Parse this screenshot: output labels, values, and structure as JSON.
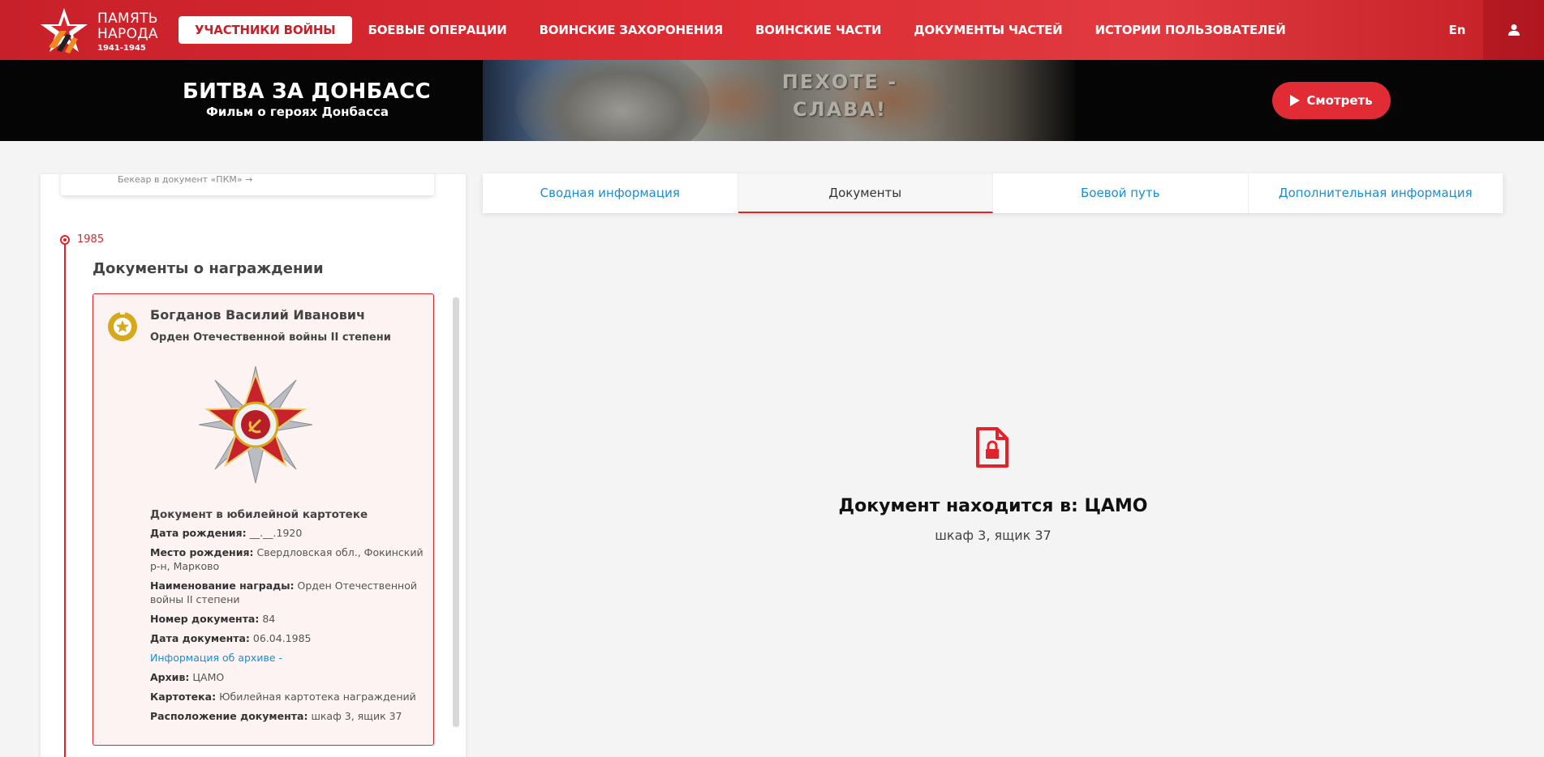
{
  "header": {
    "logo": {
      "line1": "ПАМЯТЬ",
      "line2": "НАРОДА",
      "years": "1941-1945"
    },
    "nav": [
      {
        "label": "УЧАСТНИКИ ВОЙНЫ",
        "active": true
      },
      {
        "label": "БОЕВЫЕ ОПЕРАЦИИ",
        "active": false
      },
      {
        "label": "ВОИНСКИЕ ЗАХОРОНЕНИЯ",
        "active": false
      },
      {
        "label": "ВОИНСКИЕ ЧАСТИ",
        "active": false
      },
      {
        "label": "ДОКУМЕНТЫ ЧАСТЕЙ",
        "active": false
      },
      {
        "label": "ИСТОРИИ ПОЛЬЗОВАТЕЛЕЙ",
        "active": false
      }
    ],
    "lang": "En",
    "user_icon": "user-icon"
  },
  "banner": {
    "title": "БИТВА ЗА ДОНБАСС",
    "subtitle": "Фильм о героях Донбасса",
    "inscription_line1": "ПЕХОТЕ -",
    "inscription_line2": "СЛАВА!",
    "watch_label": "Смотреть"
  },
  "sidebar": {
    "prev_card_text": "Бекеар в документ «ПКМ» →",
    "year": "1985",
    "section_title": "Документы о награждении",
    "award": {
      "name": "Богданов Василий Иванович",
      "title": "Орден Отечественной войны II степени",
      "doc_heading": "Документ в юбилейной картотеке",
      "fields": [
        {
          "label": "Дата рождения:",
          "value": "__.__.1920"
        },
        {
          "label": "Место рождения:",
          "value": "Свердловская обл., Фокинский р-н, Марково"
        },
        {
          "label": "Наименование награды:",
          "value": "Орден Отечественной войны II степени"
        },
        {
          "label": "Номер документа:",
          "value": "84"
        },
        {
          "label": "Дата документа:",
          "value": "06.04.1985"
        }
      ],
      "archive_link": "Информация об архиве -",
      "fields2": [
        {
          "label": "Архив:",
          "value": "ЦАМО"
        },
        {
          "label": "Картотека:",
          "value": "Юбилейная картотека награждений"
        },
        {
          "label": "Расположение документа:",
          "value": "шкаф 3, ящик 37"
        }
      ]
    }
  },
  "tabs": [
    {
      "label": "Сводная информация",
      "active": false
    },
    {
      "label": "Документы",
      "active": true
    },
    {
      "label": "Боевой путь",
      "active": false
    },
    {
      "label": "Дополнительная информация",
      "active": false
    }
  ],
  "main": {
    "icon": "locked-document-icon",
    "location_text": "Документ находится в: ЦАМО",
    "place_text": "шкаф 3, ящик 37"
  },
  "colors": {
    "brand_red": "#e0242c",
    "link_blue": "#1a8dd6"
  }
}
